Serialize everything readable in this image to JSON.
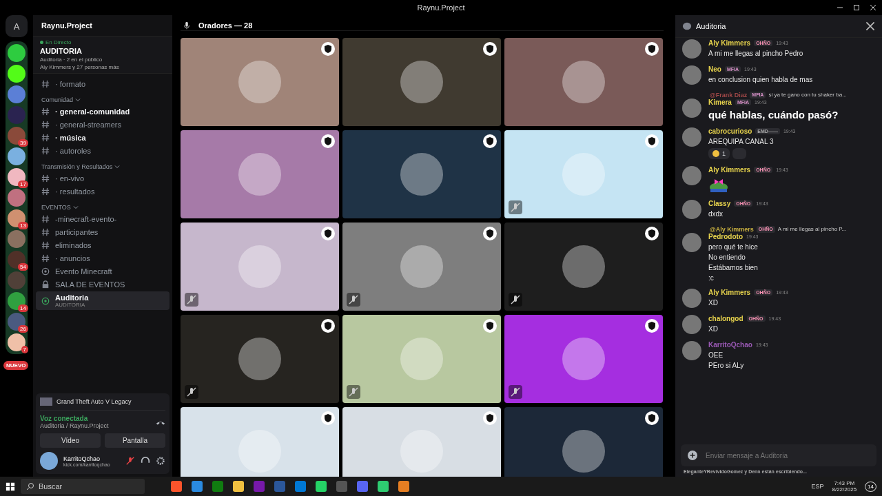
{
  "window": {
    "title": "Raynu.Project"
  },
  "servers": {
    "top_label": "A",
    "items": [
      {
        "color": "#2ecc40"
      },
      {
        "color": "#53fc18"
      },
      {
        "color": "#5b7fd6"
      },
      {
        "color": "#2a2350"
      },
      {
        "color": "#8a4a3a",
        "badge": "39"
      },
      {
        "color": "#7ab0e0"
      },
      {
        "color": "#f0b8c0",
        "badge": "17"
      },
      {
        "color": "#c07080"
      },
      {
        "color": "#d09070",
        "badge": "13"
      },
      {
        "color": "#8a7060"
      },
      {
        "color": "#503028",
        "badge": "54"
      },
      {
        "color": "#504038"
      },
      {
        "color": "#30a040",
        "badge": "14"
      },
      {
        "color": "#4a5a80",
        "badge": "26"
      },
      {
        "color": "#f0c0a8",
        "badge": "7"
      }
    ],
    "new_label": "NUEVO"
  },
  "server": {
    "name": "Raynu.Project"
  },
  "stage_banner": {
    "status": "En Directo",
    "title": "AUDITORIA",
    "info": "Auditoria · 2 en el público",
    "listeners": "Aly Kimmers y 27 personas más"
  },
  "channels": [
    {
      "kind": "text",
      "name": "· formato",
      "unread": false
    },
    {
      "kind": "category",
      "name": "Comunidad"
    },
    {
      "kind": "text",
      "name": "· general-comunidad",
      "unread": true
    },
    {
      "kind": "text",
      "name": "· general-streamers",
      "unread": false
    },
    {
      "kind": "text",
      "name": "· música",
      "unread": true
    },
    {
      "kind": "text",
      "name": "· autoroles",
      "unread": false
    },
    {
      "kind": "category",
      "name": "Transmisión y Resultados"
    },
    {
      "kind": "text",
      "name": "· en-vivo",
      "unread": false
    },
    {
      "kind": "text",
      "name": "· resultados",
      "unread": false
    },
    {
      "kind": "category",
      "name": "EVENTOS"
    },
    {
      "kind": "text",
      "name": "-minecraft-evento-",
      "unread": false
    },
    {
      "kind": "text",
      "name": "participantes",
      "unread": false
    },
    {
      "kind": "text",
      "name": "eliminados",
      "unread": false
    },
    {
      "kind": "text",
      "name": "· anuncios",
      "unread": false
    },
    {
      "kind": "stage",
      "name": "Evento Minecraft",
      "unread": false
    },
    {
      "kind": "locked",
      "name": "SALA DE EVENTOS",
      "unread": false
    },
    {
      "kind": "stage",
      "name": "Auditoria",
      "sub": "AUDITORIA",
      "unread": true,
      "selected": true
    }
  ],
  "activity": {
    "game": "Grand Theft Auto V Legacy"
  },
  "voice": {
    "status": "Voz conectada",
    "location": "Auditoria / Raynu.Project",
    "buttons": [
      "Vídeo",
      "Pantalla"
    ]
  },
  "user": {
    "name": "KarritoQchao",
    "status": "kick.com/karritoqchao",
    "muted": true
  },
  "stage": {
    "header": "Oradores — 28",
    "tiles": [
      {
        "color": "#a08478",
        "muted": false
      },
      {
        "color": "#403a30",
        "muted": false
      },
      {
        "color": "#7a5a58",
        "muted": false
      },
      {
        "color": "#a67aa8",
        "muted": false
      },
      {
        "color": "#1f3346",
        "muted": false
      },
      {
        "color": "#c5e4f3",
        "muted": true
      },
      {
        "color": "#c6b7cc",
        "muted": true
      },
      {
        "color": "#7e7e7e",
        "muted": true
      },
      {
        "color": "#1e1e1e",
        "muted": true
      },
      {
        "color": "#262420",
        "muted": true
      },
      {
        "color": "#b8c8a0",
        "muted": true
      },
      {
        "color": "#a52ee0",
        "muted": true
      },
      {
        "color": "#d8e2ea"
      },
      {
        "color": "#d8dee4"
      },
      {
        "color": "#1c2838"
      }
    ]
  },
  "chat": {
    "title": "Auditoria",
    "messages": [
      {
        "author": "Aly Kimmers",
        "color": "#e8d44d",
        "tag": "OHÑO",
        "time": "19:43",
        "lines": [
          "A mi me llegas al pincho Pedro"
        ]
      },
      {
        "author": "Neo",
        "color": "#e8d44d",
        "tag": "MFIA",
        "time": "19:43",
        "lines": [
          "en conclusion quien habla de mas"
        ]
      },
      {
        "author": "Kimera",
        "color": "#e8d44d",
        "tag": "MFIA",
        "time": "19:43",
        "reply": {
          "author": "@Frank Diaz",
          "color": "#a04848",
          "tag": "MFIA",
          "text": "si ya te gano con tu shaker ba..."
        },
        "big": true,
        "lines": [
          "qué hablas, cuándo pasó?"
        ]
      },
      {
        "author": "cabrocurioso",
        "color": "#e8d44d",
        "tag": "EMD——",
        "time": "19:43",
        "lines": [
          "AREQUIPA CANAL 3"
        ],
        "reaction": "1"
      },
      {
        "author": "Aly Kimmers",
        "color": "#e8d44d",
        "tag": "OHÑO",
        "time": "19:43",
        "kind": "sticker"
      },
      {
        "author": "Classy",
        "color": "#e8d44d",
        "tag": "OHÑO",
        "time": "19:43",
        "lines": [
          "dxdx"
        ]
      },
      {
        "author": "Pedrodoto",
        "color": "#e8d44d",
        "time": "19:43",
        "reply": {
          "author": "@Aly Kimmers",
          "color": "#c8b040",
          "tag": "OHÑO",
          "text": "A mi me llegas al pincho P..."
        },
        "lines": [
          "pero qué te hice",
          "No entiendo",
          "Estábamos bien",
          ":c"
        ]
      },
      {
        "author": "Aly Kimmers",
        "color": "#e8d44d",
        "tag": "OHÑO",
        "time": "19:43",
        "lines": [
          "XD"
        ]
      },
      {
        "author": "chalongod",
        "color": "#e8d44d",
        "tag": "OHÑO",
        "time": "19:43",
        "lines": [
          "XD"
        ]
      },
      {
        "author": "KarritoQchao",
        "color": "#9b59b6",
        "time": "19:43",
        "lines": [
          "OEE",
          "PEro si ALy"
        ]
      }
    ],
    "input": {
      "placeholder": "Enviar mensaje a Auditoria"
    },
    "typing": "EleganteYRevividoGomez y Denn están escribiendo..."
  },
  "taskbar": {
    "search": "Buscar",
    "lang": "ESP",
    "time": "7:43 PM",
    "date": "8/22/2025",
    "notifications": "14"
  }
}
